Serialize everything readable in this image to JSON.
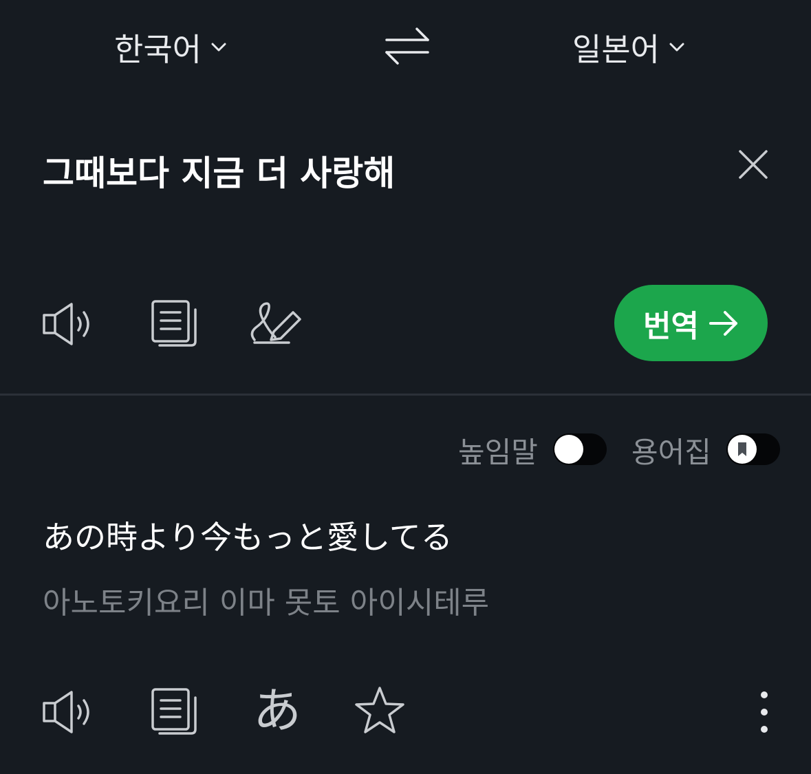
{
  "languages": {
    "source": "한국어",
    "target": "일본어"
  },
  "input": {
    "text": "그때보다 지금 더 사랑해"
  },
  "actions": {
    "translate_label": "번역"
  },
  "options": {
    "honorific_label": "높임말",
    "honorific_on": false,
    "glossary_label": "용어집",
    "glossary_on": false
  },
  "result": {
    "text": "あの時より今もっと愛してる",
    "pronunciation": "아노토키요리 이마 못토 아이시테루",
    "romaji_glyph": "あ"
  },
  "colors": {
    "background": "#161b21",
    "accent": "#1ca64c"
  },
  "icons": [
    "chevron-down-icon",
    "swap-icon",
    "close-icon",
    "speaker-icon",
    "copy-icon",
    "handwriting-icon",
    "arrow-right-icon",
    "bookmark-icon",
    "star-icon",
    "more-vertical-icon"
  ]
}
